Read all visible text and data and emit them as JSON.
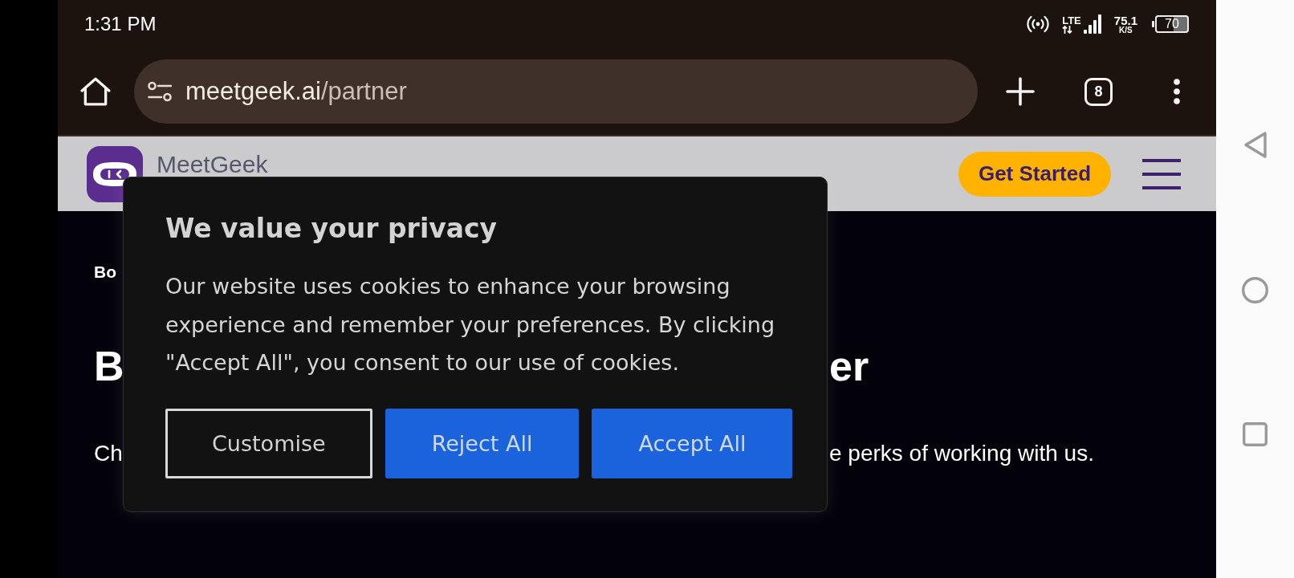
{
  "status_bar": {
    "time": "1:31 PM",
    "network_type": "LTE",
    "speed": "75.1",
    "speed_unit": "K/S",
    "battery": "70"
  },
  "browser_toolbar": {
    "url_host": "meetgeek.ai",
    "url_path": "/partner",
    "tab_count": "8"
  },
  "site_header": {
    "brand": "MeetGeek",
    "cta_button": "Get Started"
  },
  "page_content": {
    "breadcrumb": "Bo",
    "heading_start": "B",
    "heading_end": "er",
    "intro_start": "Ch",
    "intro_end": "e perks of working with us."
  },
  "cookie_dialog": {
    "title": "We value your privacy",
    "message": "Our website uses cookies to enhance your browsing experience and remember your preferences. By clicking \"Accept All\", you consent to our use of cookies.",
    "buttons": [
      {
        "label": "Customise",
        "kind": "outline"
      },
      {
        "label": "Reject All",
        "kind": "filled"
      },
      {
        "label": "Accept All",
        "kind": "filled"
      }
    ]
  }
}
